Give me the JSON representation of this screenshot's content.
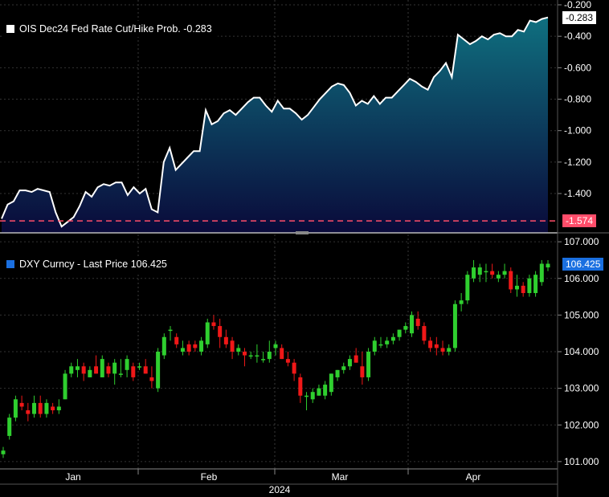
{
  "chart_data": [
    {
      "type": "area",
      "legend": "OIS Dec24 Fed Rate Cut/Hike Prob. -0.283",
      "legend_color": "#ffffff",
      "last_value_label": "-0.283",
      "reference_label": "-1.574",
      "reference_value": -1.574,
      "line_color": "#ffffff",
      "fill_color_top": "#0f6f7f",
      "fill_color_bottom": "#0a0a3a",
      "reference_color": "#ff4d6a",
      "ylim": [
        -1.65,
        -0.2
      ],
      "yticks": [
        -0.2,
        -0.4,
        -0.6,
        -0.8,
        -1.0,
        -1.2,
        -1.4
      ],
      "ytick_labels": [
        "-0.200",
        "-0.400",
        "-0.600",
        "-0.800",
        "-1.000",
        "-1.200",
        "-1.400"
      ],
      "values": [
        -1.56,
        -1.47,
        -1.45,
        -1.38,
        -1.38,
        -1.39,
        -1.37,
        -1.38,
        -1.39,
        -1.52,
        -1.61,
        -1.58,
        -1.55,
        -1.48,
        -1.39,
        -1.42,
        -1.36,
        -1.34,
        -1.35,
        -1.33,
        -1.33,
        -1.41,
        -1.36,
        -1.4,
        -1.37,
        -1.5,
        -1.52,
        -1.2,
        -1.11,
        -1.25,
        -1.21,
        -1.17,
        -1.13,
        -1.13,
        -0.87,
        -0.96,
        -0.94,
        -0.89,
        -0.87,
        -0.9,
        -0.86,
        -0.82,
        -0.79,
        -0.79,
        -0.84,
        -0.88,
        -0.81,
        -0.86,
        -0.86,
        -0.89,
        -0.93,
        -0.9,
        -0.85,
        -0.8,
        -0.76,
        -0.72,
        -0.7,
        -0.71,
        -0.76,
        -0.84,
        -0.81,
        -0.83,
        -0.78,
        -0.83,
        -0.79,
        -0.79,
        -0.75,
        -0.71,
        -0.67,
        -0.69,
        -0.72,
        -0.74,
        -0.66,
        -0.62,
        -0.57,
        -0.66,
        -0.39,
        -0.42,
        -0.45,
        -0.43,
        -0.4,
        -0.42,
        -0.39,
        -0.38,
        -0.4,
        -0.4,
        -0.36,
        -0.37,
        -0.3,
        -0.31,
        -0.29,
        -0.28
      ]
    },
    {
      "type": "candlestick",
      "legend": "DXY Curncy - Last Price 106.425",
      "legend_color": "#1a6fe0",
      "last_value_label": "106.425",
      "up_color": "#2fcf2f",
      "down_color": "#f01818",
      "ylim": [
        100.8,
        107.2
      ],
      "yticks": [
        101,
        102,
        103,
        104,
        105,
        106,
        107
      ],
      "ytick_labels": [
        "101.000",
        "102.000",
        "103.000",
        "104.000",
        "105.000",
        "106.000",
        "107.000"
      ],
      "x_tick_labels": [
        "Jan",
        "Feb",
        "Mar",
        "Apr"
      ],
      "x_year_label": "2024",
      "ohlc": [
        [
          101.2,
          101.4,
          101.1,
          101.3
        ],
        [
          101.7,
          102.3,
          101.6,
          102.2
        ],
        [
          102.2,
          102.8,
          102.1,
          102.7
        ],
        [
          102.6,
          102.8,
          102.4,
          102.5
        ],
        [
          102.4,
          102.6,
          102.1,
          102.3
        ],
        [
          102.3,
          102.8,
          102.2,
          102.6
        ],
        [
          102.6,
          102.8,
          102.2,
          102.3
        ],
        [
          102.3,
          102.7,
          102.2,
          102.6
        ],
        [
          102.5,
          102.6,
          102.3,
          102.4
        ],
        [
          102.4,
          102.7,
          102.3,
          102.5
        ],
        [
          102.7,
          103.5,
          102.7,
          103.4
        ],
        [
          103.4,
          103.7,
          103.3,
          103.6
        ],
        [
          103.5,
          103.8,
          103.3,
          103.6
        ],
        [
          103.6,
          103.7,
          103.2,
          103.4
        ],
        [
          103.3,
          103.6,
          103.3,
          103.5
        ],
        [
          103.6,
          103.9,
          103.4,
          103.4
        ],
        [
          103.3,
          103.9,
          103.3,
          103.8
        ],
        [
          103.6,
          103.7,
          103.3,
          103.4
        ],
        [
          103.4,
          103.8,
          103.1,
          103.7
        ],
        [
          103.4,
          103.8,
          103.3,
          103.4
        ],
        [
          103.5,
          103.9,
          103.3,
          103.8
        ],
        [
          103.6,
          103.7,
          103.2,
          103.3
        ],
        [
          103.6,
          103.7,
          103.5,
          103.6
        ],
        [
          103.6,
          103.8,
          103.4,
          103.4
        ],
        [
          103.3,
          103.6,
          103.0,
          103.2
        ],
        [
          103.0,
          104.1,
          102.9,
          104.0
        ],
        [
          103.9,
          104.5,
          103.8,
          104.4
        ],
        [
          104.6,
          104.7,
          104.3,
          104.6
        ],
        [
          104.4,
          104.5,
          104.1,
          104.2
        ],
        [
          104.0,
          104.3,
          103.9,
          104.1
        ],
        [
          104.2,
          104.3,
          103.9,
          104.0
        ],
        [
          104.2,
          104.3,
          104.0,
          104.1
        ],
        [
          104.0,
          104.4,
          103.9,
          104.3
        ],
        [
          104.2,
          104.9,
          104.1,
          104.8
        ],
        [
          104.8,
          105.0,
          104.6,
          104.7
        ],
        [
          104.7,
          104.9,
          104.1,
          104.4
        ],
        [
          104.4,
          104.6,
          104.1,
          104.2
        ],
        [
          104.3,
          104.4,
          103.8,
          104.0
        ],
        [
          104.0,
          104.2,
          103.9,
          104.1
        ],
        [
          104.0,
          104.1,
          103.6,
          103.9
        ],
        [
          103.9,
          104.0,
          103.8,
          103.9
        ],
        [
          103.9,
          104.2,
          103.7,
          103.9
        ],
        [
          103.8,
          104.0,
          103.7,
          103.8
        ],
        [
          103.8,
          104.3,
          103.7,
          104.0
        ],
        [
          104.1,
          104.3,
          103.9,
          104.2
        ],
        [
          104.1,
          104.2,
          103.8,
          103.8
        ],
        [
          103.8,
          104.0,
          103.6,
          103.7
        ],
        [
          103.7,
          103.8,
          103.2,
          103.4
        ],
        [
          103.3,
          103.4,
          102.6,
          102.8
        ],
        [
          102.8,
          102.9,
          102.4,
          102.8
        ],
        [
          102.7,
          103.0,
          102.6,
          102.9
        ],
        [
          102.8,
          103.1,
          102.8,
          103.0
        ],
        [
          102.8,
          103.2,
          102.7,
          103.1
        ],
        [
          102.9,
          103.4,
          102.8,
          103.4
        ],
        [
          103.3,
          103.5,
          103.2,
          103.5
        ],
        [
          103.5,
          103.7,
          103.4,
          103.6
        ],
        [
          103.6,
          103.9,
          103.5,
          103.8
        ],
        [
          103.9,
          104.1,
          103.7,
          103.7
        ],
        [
          103.6,
          104.0,
          103.1,
          103.3
        ],
        [
          103.3,
          104.1,
          103.2,
          104.0
        ],
        [
          104.0,
          104.4,
          103.9,
          104.3
        ],
        [
          104.2,
          104.4,
          104.1,
          104.2
        ],
        [
          104.2,
          104.4,
          104.1,
          104.3
        ],
        [
          104.3,
          104.5,
          104.2,
          104.4
        ],
        [
          104.4,
          104.6,
          104.3,
          104.6
        ],
        [
          104.6,
          104.8,
          104.5,
          104.7
        ],
        [
          104.5,
          105.1,
          104.4,
          105.0
        ],
        [
          104.9,
          105.1,
          104.6,
          104.7
        ],
        [
          104.7,
          104.8,
          104.2,
          104.3
        ],
        [
          104.3,
          104.4,
          104.0,
          104.1
        ],
        [
          104.2,
          104.4,
          103.9,
          104.1
        ],
        [
          104.1,
          104.3,
          103.9,
          104.0
        ],
        [
          104.0,
          104.2,
          103.9,
          104.1
        ],
        [
          104.1,
          105.4,
          104.0,
          105.3
        ],
        [
          105.3,
          105.6,
          105.1,
          105.4
        ],
        [
          105.4,
          106.2,
          105.3,
          106.1
        ],
        [
          106.0,
          106.5,
          105.9,
          106.3
        ],
        [
          106.1,
          106.4,
          105.9,
          106.3
        ],
        [
          106.2,
          106.4,
          105.9,
          106.2
        ],
        [
          106.2,
          106.4,
          106.0,
          106.1
        ],
        [
          106.0,
          106.2,
          105.9,
          106.1
        ],
        [
          106.1,
          106.4,
          106.0,
          106.2
        ],
        [
          106.2,
          106.3,
          105.6,
          105.7
        ],
        [
          105.7,
          106.1,
          105.5,
          105.8
        ],
        [
          105.8,
          105.9,
          105.5,
          105.6
        ],
        [
          105.6,
          106.1,
          105.5,
          106.0
        ],
        [
          105.6,
          106.2,
          105.5,
          106.1
        ],
        [
          105.9,
          106.5,
          105.8,
          106.4
        ],
        [
          106.3,
          106.5,
          106.2,
          106.4
        ]
      ]
    }
  ]
}
